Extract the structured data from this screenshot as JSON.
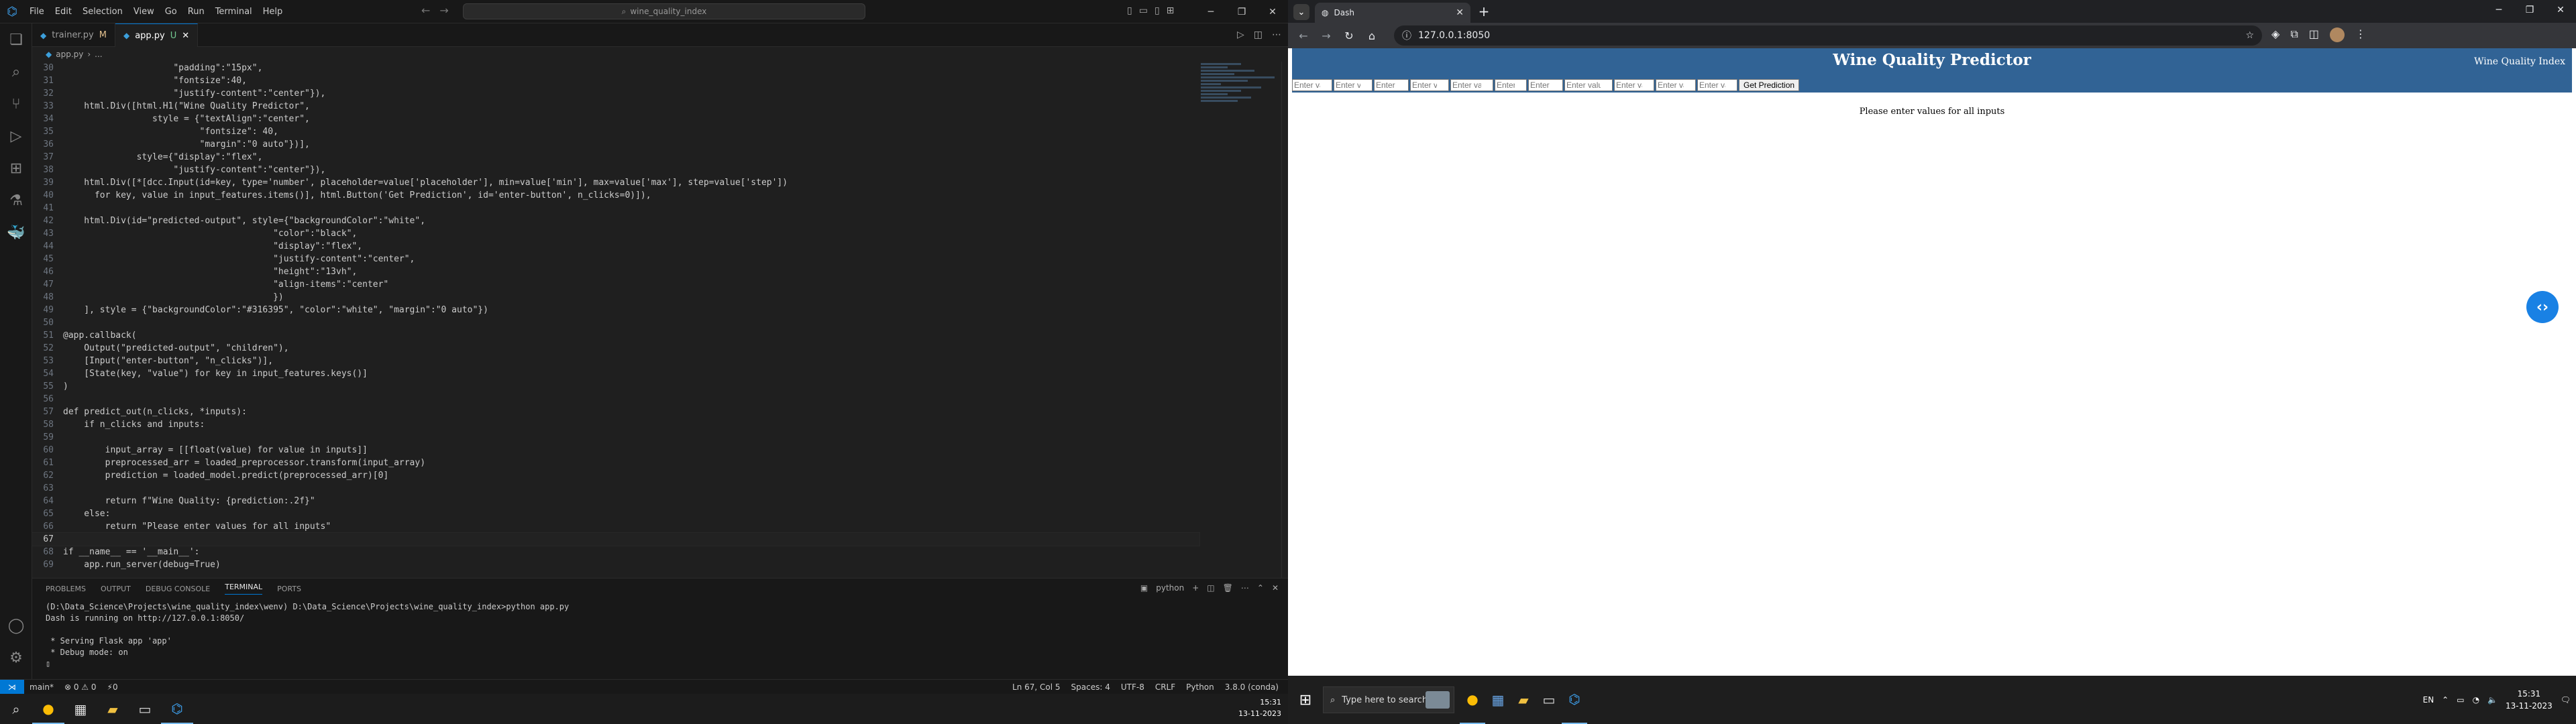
{
  "vscode": {
    "menu": [
      "File",
      "Edit",
      "Selection",
      "View",
      "Go",
      "Run",
      "Terminal",
      "Help"
    ],
    "search_text": "wine_quality_index",
    "tabs": [
      {
        "label": "trainer.py",
        "marker": "M",
        "active": false
      },
      {
        "label": "app.py",
        "marker": "U",
        "active": true
      }
    ],
    "breadcrumb": [
      "app.py",
      "..."
    ],
    "code": [
      {
        "n": "30",
        "t": "                     \"padding\":\"15px\","
      },
      {
        "n": "31",
        "t": "                     \"fontsize\":40,"
      },
      {
        "n": "32",
        "t": "                     \"justify-content\":\"center\"}),"
      },
      {
        "n": "33",
        "t": "    html.Div([html.H1(\"Wine Quality Predictor\","
      },
      {
        "n": "34",
        "t": "                 style = {\"textAlign\":\"center\","
      },
      {
        "n": "35",
        "t": "                          \"fontsize\": 40,"
      },
      {
        "n": "36",
        "t": "                          \"margin\":\"0 auto\"})],"
      },
      {
        "n": "37",
        "t": "              style={\"display\":\"flex\","
      },
      {
        "n": "38",
        "t": "                     \"justify-content\":\"center\"}),"
      },
      {
        "n": "39",
        "t": "    html.Div([*[dcc.Input(id=key, type='number', placeholder=value['placeholder'], min=value['min'], max=value['max'], step=value['step'])"
      },
      {
        "n": "40",
        "t": "      for key, value in input_features.items()], html.Button('Get Prediction', id='enter-button', n_clicks=0)]),"
      },
      {
        "n": "41",
        "t": ""
      },
      {
        "n": "42",
        "t": "    html.Div(id=\"predicted-output\", style={\"backgroundColor\":\"white\","
      },
      {
        "n": "43",
        "t": "                                        \"color\":\"black\","
      },
      {
        "n": "44",
        "t": "                                        \"display\":\"flex\","
      },
      {
        "n": "45",
        "t": "                                        \"justify-content\":\"center\","
      },
      {
        "n": "46",
        "t": "                                        \"height\":\"13vh\","
      },
      {
        "n": "47",
        "t": "                                        \"align-items\":\"center\""
      },
      {
        "n": "48",
        "t": "                                        })"
      },
      {
        "n": "49",
        "t": "    ], style = {\"backgroundColor\":\"#316395\", \"color\":\"white\", \"margin\":\"0 auto\"})"
      },
      {
        "n": "50",
        "t": ""
      },
      {
        "n": "51",
        "t": "@app.callback("
      },
      {
        "n": "52",
        "t": "    Output(\"predicted-output\", \"children\"),"
      },
      {
        "n": "53",
        "t": "    [Input(\"enter-button\", \"n_clicks\")],"
      },
      {
        "n": "54",
        "t": "    [State(key, \"value\") for key in input_features.keys()]"
      },
      {
        "n": "55",
        "t": ")"
      },
      {
        "n": "56",
        "t": ""
      },
      {
        "n": "57",
        "t": "def predict_out(n_clicks, *inputs):"
      },
      {
        "n": "58",
        "t": "    if n_clicks and inputs:"
      },
      {
        "n": "59",
        "t": ""
      },
      {
        "n": "60",
        "t": "        input_array = [[float(value) for value in inputs]]"
      },
      {
        "n": "61",
        "t": "        preprocessed_arr = loaded_preprocessor.transform(input_array)"
      },
      {
        "n": "62",
        "t": "        prediction = loaded_model.predict(preprocessed_arr)[0]"
      },
      {
        "n": "63",
        "t": ""
      },
      {
        "n": "64",
        "t": "        return f\"Wine Quality: {prediction:.2f}\""
      },
      {
        "n": "65",
        "t": "    else:"
      },
      {
        "n": "66",
        "t": "        return \"Please enter values for all inputs\""
      },
      {
        "n": "67",
        "t": ""
      },
      {
        "n": "68",
        "t": "if __name__ == '__main__':"
      },
      {
        "n": "69",
        "t": "    app.run_server(debug=True)"
      }
    ],
    "current_line": "67",
    "panel_tabs": [
      "PROBLEMS",
      "OUTPUT",
      "DEBUG CONSOLE",
      "TERMINAL",
      "PORTS"
    ],
    "active_panel_tab": "TERMINAL",
    "terminal_shell": "python",
    "terminal_lines": [
      "(D:\\Data_Science\\Projects\\wine_quality_index\\wenv) D:\\Data_Science\\Projects\\wine_quality_index>python app.py",
      "Dash is running on http://127.0.0.1:8050/",
      "",
      " * Serving Flask app 'app'",
      " * Debug mode: on"
    ],
    "status_left": [
      "main*",
      "⊗ 0 ⚠ 0",
      "⚡0"
    ],
    "status_right": [
      "Ln 67, Col 5",
      "Spaces: 4",
      "UTF-8",
      "CRLF",
      "Python",
      "3.8.0 (conda)"
    ],
    "taskbar_clock": {
      "time": "15:31",
      "date": "13-11-2023"
    }
  },
  "chrome": {
    "tab_title": "Dash",
    "url": "127.0.0.1:8050",
    "dash": {
      "title": "Wine Quality Predictor",
      "brand": "Wine Quality Index",
      "banner_color": "#316395",
      "input_placeholders": [
        "Enter valu",
        "Enter valu",
        "Enter va",
        "Enter valu",
        "Enter value",
        "Enter v",
        "Enter va",
        "Enter value f",
        "Enter valu",
        "Enter valu",
        "Enter valu"
      ],
      "button_label": "Get Prediction",
      "output_text": "Please enter values for all inputs"
    },
    "taskbar": {
      "search_placeholder": "Type here to search",
      "lang": "EN",
      "time": "15:31",
      "date": "13-11-2023"
    }
  }
}
